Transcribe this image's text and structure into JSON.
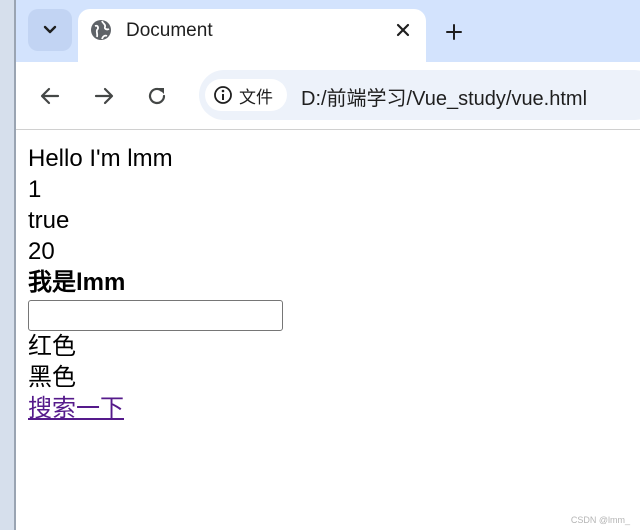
{
  "browser": {
    "tab": {
      "title": "Document"
    },
    "address_bar": {
      "site_label": "文件",
      "url": "D:/前端学习/Vue_study/vue.html"
    }
  },
  "page": {
    "lines": [
      "Hello I'm lmm",
      "1",
      "true",
      "20"
    ],
    "bold_line": "我是lmm",
    "input": {
      "value": "",
      "placeholder": ""
    },
    "color_items": [
      "红色",
      "黑色"
    ],
    "link": {
      "label": "搜索一下"
    }
  },
  "watermark": "CSDN @lmm_",
  "colors": {
    "tabstrip": "#d3e3fd",
    "omnibox": "#edf2fa",
    "visited_link": "#551a8b"
  }
}
